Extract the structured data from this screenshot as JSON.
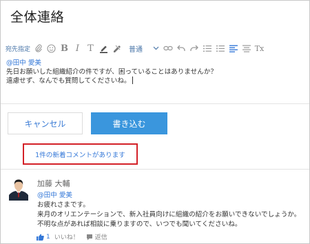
{
  "title": "全体連絡",
  "toolbar": {
    "mention_label": "宛先指定",
    "font_size_value": "普通",
    "bold": "B",
    "italic": "I",
    "text_t": "T",
    "clear_format": "Tx"
  },
  "editor": {
    "mention": "@田中 愛美",
    "line1": "先日お願いした組織紹介の件ですが、困っていることはありませんか？",
    "line2": "遠慮せず、なんでも質問してくださいね。"
  },
  "buttons": {
    "cancel": "キャンセル",
    "submit": "書き込む"
  },
  "notice": "1件の新着コメントがあります",
  "comment": {
    "author": "加藤 大輔",
    "mention": "@田中 愛美",
    "line1": "お疲れさまです。",
    "line2": "来月のオリエンテーションで、新入社員向けに組織の紹介をお願いできないでしょうか。",
    "line3": "不明な点があれば相談に乗りますので、いつでも聞いてくださいね。",
    "like_count": "1",
    "like_label": "いいね！",
    "reply_label": "返信"
  },
  "colors": {
    "accent": "#3a96dd",
    "link": "#3478d8",
    "highlight_border": "#d32027"
  }
}
